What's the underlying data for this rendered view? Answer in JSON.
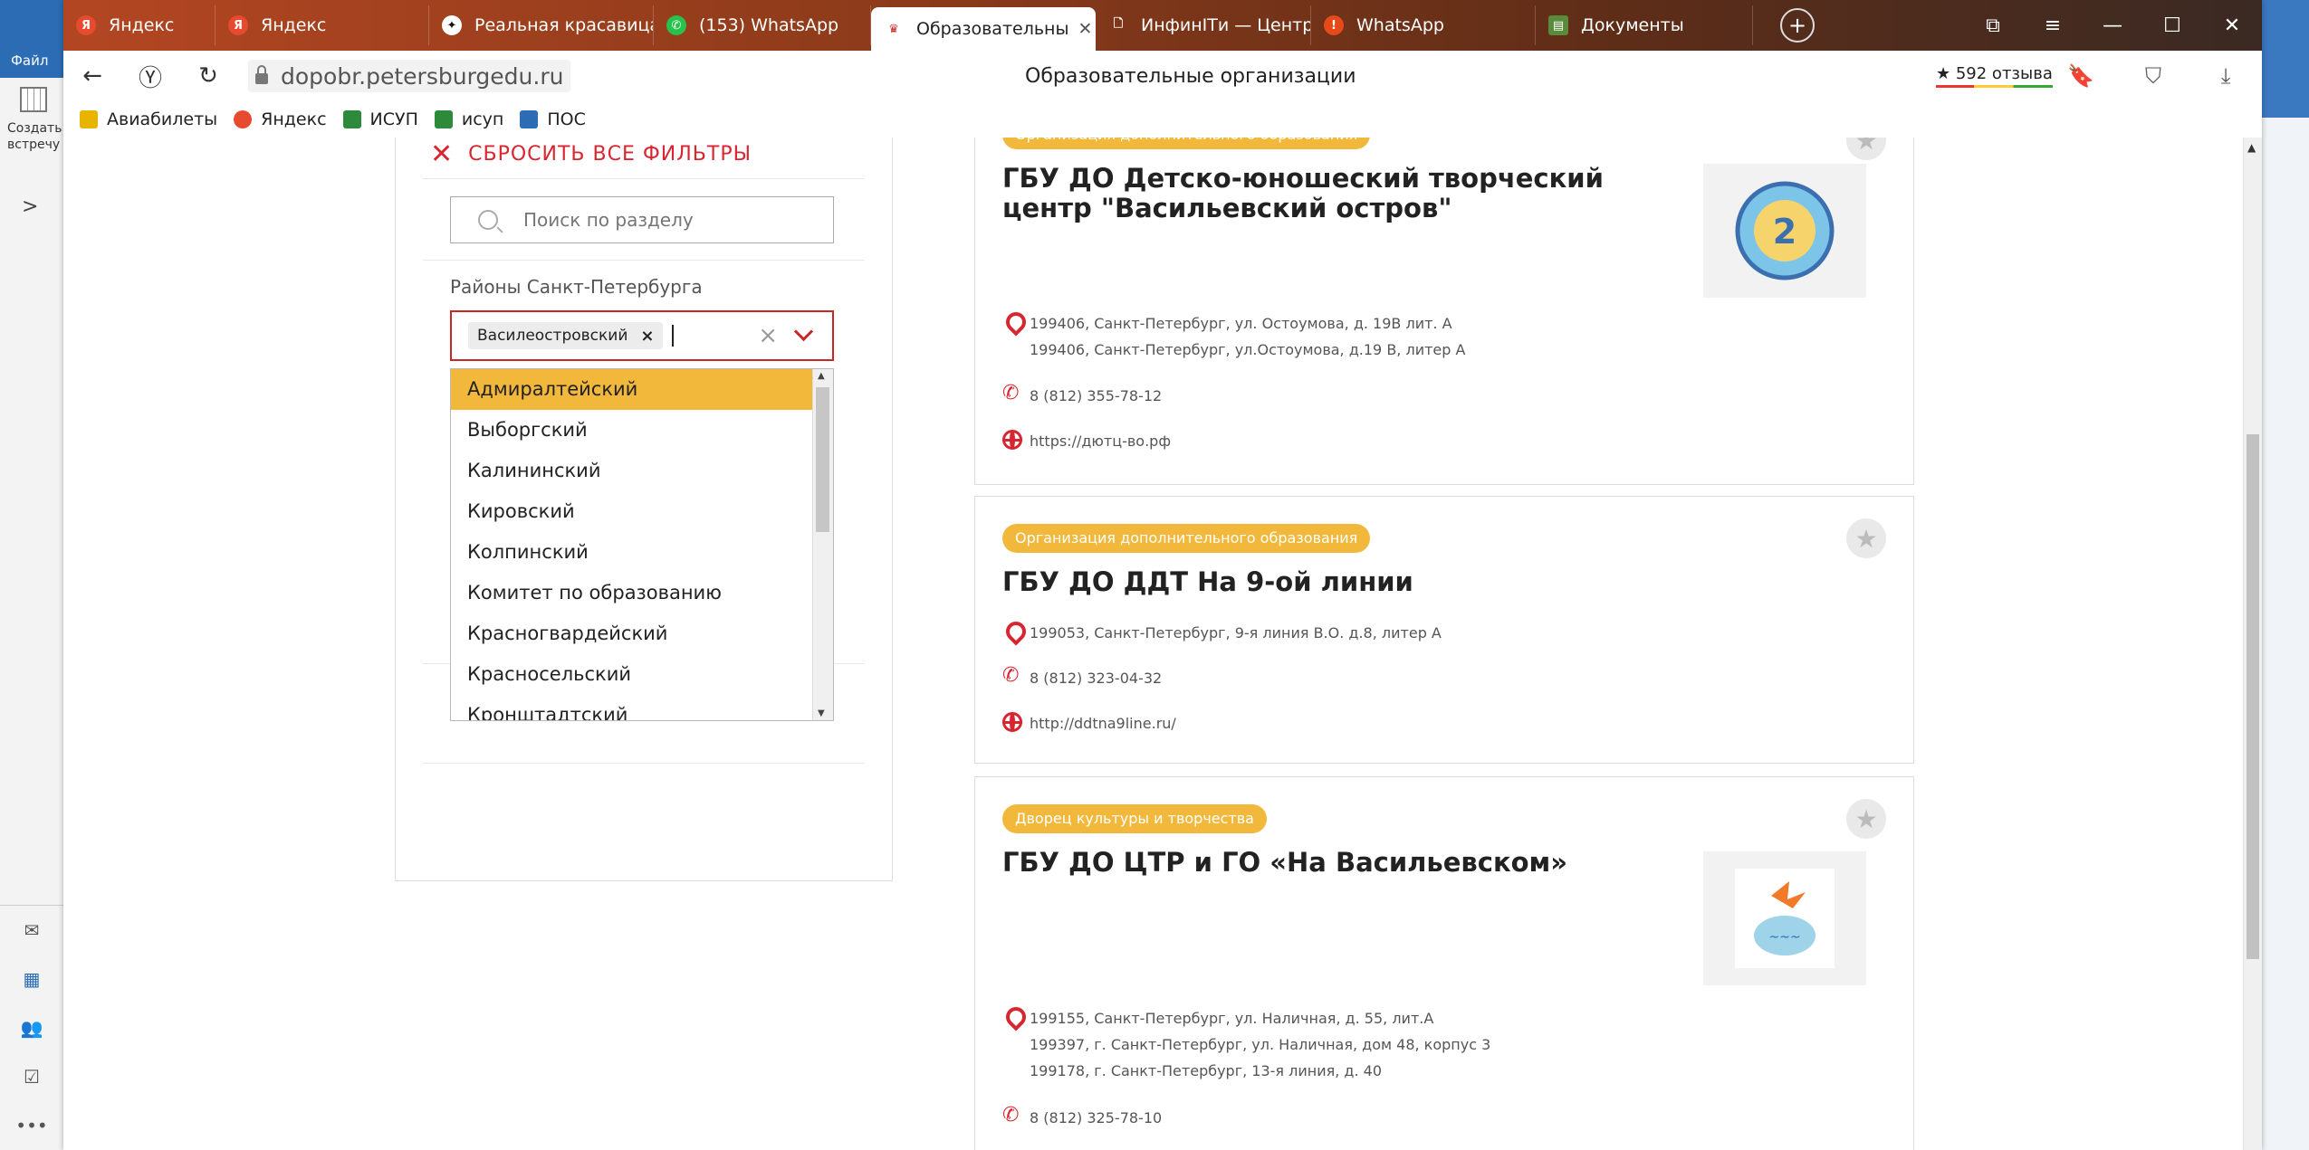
{
  "bg_app": {
    "file_label": "Файл",
    "create_label": "Создать встречу",
    "expand_label": ">"
  },
  "tabs": [
    {
      "label": "Яндекс",
      "icon": "yandex-icon"
    },
    {
      "label": "Яндекс",
      "icon": "yandex-icon"
    },
    {
      "label": "Реальная красавица",
      "icon": "star-icon"
    },
    {
      "label": "(153) WhatsApp",
      "icon": "whatsapp-icon"
    },
    {
      "label": "Образовательны",
      "icon": "emblem-icon",
      "active": true
    },
    {
      "label": "ИнфинIТи — Центр",
      "icon": "document-icon"
    },
    {
      "label": "WhatsApp",
      "icon": "warning-icon"
    },
    {
      "label": "Документы",
      "icon": "documents-icon"
    }
  ],
  "address": {
    "url": "dopobr.petersburgedu.ru",
    "page_title": "Образовательные организации",
    "reviews": "★ 592 отзыва"
  },
  "bookmarks": [
    {
      "label": "Авиабилеты",
      "color": "#e8b400"
    },
    {
      "label": "Яндекс",
      "color": "#e84a2f"
    },
    {
      "label": "ИСУП",
      "color": "#2d8a3a"
    },
    {
      "label": "исуп",
      "color": "#2d8a3a"
    },
    {
      "label": "ПОС",
      "color": "#2b6cb4"
    }
  ],
  "filter": {
    "reset_label": "СБРОСИТЬ ВСЕ ФИЛЬТРЫ",
    "search_placeholder": "Поиск по разделу",
    "district_label": "Районы Санкт-Петербурга",
    "selected_chip": "Василеостровский",
    "options": [
      "Адмиралтейский",
      "Выборгский",
      "Калининский",
      "Кировский",
      "Колпинский",
      "Комитет по образованию",
      "Красногвардейский",
      "Красносельский",
      "Кронштадтский"
    ]
  },
  "cards": [
    {
      "badge": "Организация дополнительного образования",
      "title": "ГБУ ДО Детско-юношеский творческий центр \"Васильевский остров\"",
      "addresses": [
        "199406, Санкт-Петербург, ул. Остоумова, д. 19В лит. А",
        "199406, Санкт-Петербург, ул.Остоумова, д.19 В, литер А"
      ],
      "phone": "8 (812) 355-78-12",
      "site": "https://дютц-во.рф"
    },
    {
      "badge": "Организация дополнительного образования",
      "title": "ГБУ ДО ДДТ На 9-ой линии",
      "addresses": [
        "199053, Санкт-Петербург, 9-я линия В.О. д.8, литер А"
      ],
      "phone": "8 (812) 323-04-32",
      "site": "http://ddtna9line.ru/"
    },
    {
      "badge": "Дворец культуры и творчества",
      "title": "ГБУ ДО ЦТР и ГО «На Васильевском»",
      "addresses": [
        "199155, Санкт-Петербург, ул. Наличная, д. 55, лит.А",
        "199397, г. Санкт-Петербург, ул. Наличная, дом 48, корпус 3",
        "199178, г. Санкт-Петербург, 13-я линия, д. 40"
      ],
      "phone": "8 (812) 325-78-10"
    }
  ],
  "colors": {
    "accent": "#d9252f",
    "badge": "#f2b83b"
  }
}
